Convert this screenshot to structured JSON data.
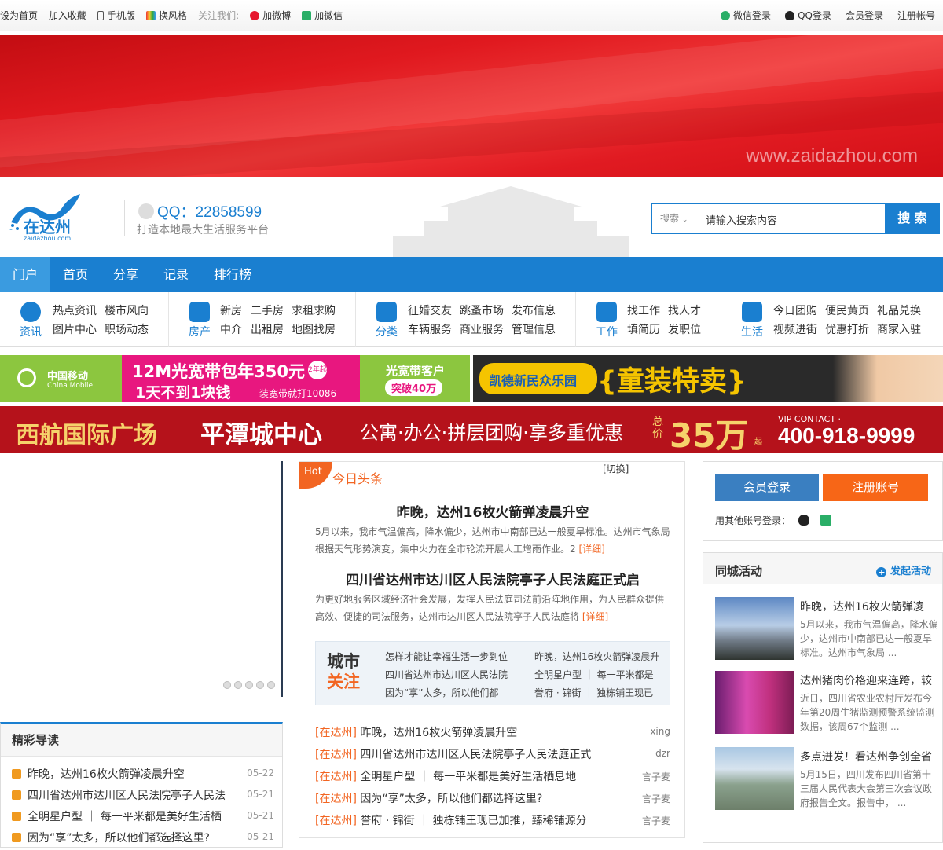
{
  "topbar": {
    "left": [
      "设为首页",
      "加入收藏",
      "手机版",
      "换风格",
      "关注我们:",
      "加微博",
      "加微信"
    ],
    "right": [
      "微信登录",
      "QQ登录",
      "会员登录",
      "注册帐号"
    ]
  },
  "banner": {
    "watermark": "www.zaidazhou.com"
  },
  "header": {
    "logo_text": "在达州",
    "logo_sub": "zaidazhou.com",
    "qq": "QQ：22858599",
    "slogan": "打造本地最大生活服务平台",
    "search_select": "搜索",
    "search_value": "请输入搜索内容",
    "search_button": "搜 索"
  },
  "nav": [
    "门户",
    "首页",
    "分享",
    "记录",
    "排行榜"
  ],
  "quick": [
    {
      "cap": "资讯",
      "links": [
        "热点资讯",
        "楼市风向",
        "图片中心",
        "职场动态"
      ]
    },
    {
      "cap": "房产",
      "links": [
        "新房",
        "二手房",
        "求租求购",
        "中介",
        "出租房",
        "地图找房"
      ]
    },
    {
      "cap": "分类",
      "links": [
        "征婚交友",
        "跳蚤市场",
        "发布信息",
        "车辆服务",
        "商业服务",
        "管理信息"
      ]
    },
    {
      "cap": "工作",
      "links": [
        "找工作",
        "找人才",
        "填简历",
        "发职位"
      ]
    },
    {
      "cap": "生活",
      "links": [
        "今日团购",
        "便民黄页",
        "礼品兑换",
        "视频进街",
        "优惠打折",
        "商家入驻"
      ]
    }
  ],
  "ads": {
    "mobile_brand": "中国移动",
    "mobile_brand_en": "China Mobile",
    "mobile_title": "12M光宽带包年350元",
    "mobile_badge": "2年起",
    "mobile_sub": "1天不到1块钱",
    "mobile_note": "装宽带就打10086",
    "mobile_right1": "光宽带客户",
    "mobile_right2": "突破40万",
    "kids_brand": "凯德新民众乐园",
    "kids_title": "{童装特卖}",
    "estate_name": "西航国际广场",
    "estate_center": "平潭城中心",
    "estate_desc": "公寓·办公·拼层团购·享多重优惠",
    "estate_price_label": "总价",
    "estate_price": "35万",
    "estate_price_suffix": "起",
    "estate_vip": "VIP CONTACT ·",
    "estate_phone": "400-918-9999"
  },
  "guide": {
    "title": "精彩导读",
    "items": [
      {
        "t": "昨晚，达州16枚火箭弹凌晨升空",
        "d": "05-22"
      },
      {
        "t": "四川省达州市达川区人民法院亭子人民法",
        "d": "05-21"
      },
      {
        "t": "全明星户型 ｜ 每一平米都是美好生活栖",
        "d": "05-21"
      },
      {
        "t": "因为“享”太多，所以他们都选择这里?",
        "d": "05-21"
      }
    ]
  },
  "news": {
    "hot": "Hot",
    "title": "今日头条",
    "switch": "[切换]",
    "headlines": [
      {
        "title": "昨晚，达州16枚火箭弹凌晨升空",
        "summary": "5月以来，我市气温偏高，降水偏少，达州市中南部已达一般夏旱标准。达州市气象局根据天气形势演变，集中火力在全市轮流开展人工增雨作业。2",
        "detail": "[详细]"
      },
      {
        "title": "四川省达州市达川区人民法院亭子人民法庭正式启",
        "summary": "为更好地服务区域经济社会发展，发挥人民法庭司法前沿阵地作用，为人民群众提供高效、便捷的司法服务，达州市达川区人民法院亭子人民法庭将",
        "detail": "[详细]"
      }
    ],
    "city_label": [
      "城市",
      "关注"
    ],
    "city_items": [
      "怎样才能让幸福生活一步到位",
      "昨晚，达州16枚火箭弹凌晨升",
      "四川省达州市达川区人民法院",
      "全明星户型 ｜ 每一平米都是",
      "因为“享”太多，所以他们都",
      "誉府 · 锦街 ｜ 独栋铺王现已"
    ],
    "list": [
      {
        "tag": "[在达州]",
        "t": "昨晚，达州16枚火箭弹凌晨升空",
        "a": "xing"
      },
      {
        "tag": "[在达州]",
        "t": "四川省达州市达川区人民法院亭子人民法庭正式",
        "a": "dzr"
      },
      {
        "tag": "[在达州]",
        "t": "全明星户型 ｜ 每一平米都是美好生活栖息地",
        "a": "言子麦"
      },
      {
        "tag": "[在达州]",
        "t": "因为“享”太多，所以他们都选择这里?",
        "a": "言子麦"
      },
      {
        "tag": "[在达州]",
        "t": "誉府 · 锦街 ｜ 独栋铺王现已加推，臻稀铺源分",
        "a": "言子麦"
      }
    ]
  },
  "login": {
    "member": "会员登录",
    "register": "注册账号",
    "other": "用其他账号登录："
  },
  "activity": {
    "title": "同城活动",
    "publish": "发起活动",
    "items": [
      {
        "t": "昨晚，达州16枚火箭弹凌",
        "s": "5月以来，我市气温偏高，降水偏少，达州市中南部已达一般夏旱标准。达州市气象局 ..."
      },
      {
        "t": "达州猪肉价格迎来连跨，较",
        "s": "近日，四川省农业农村厅发布今年第20周生猪监测预警系统监测数据，该周67个监测 ..."
      },
      {
        "t": "多点迸发！看达州争创全省",
        "s": "5月15日，四川发布四川省第十三届人民代表大会第三次会议政府报告全文。报告中， ..."
      }
    ]
  },
  "colors": {
    "brand": "#1a7fd0",
    "accent": "#f26522",
    "register": "#f76617"
  }
}
